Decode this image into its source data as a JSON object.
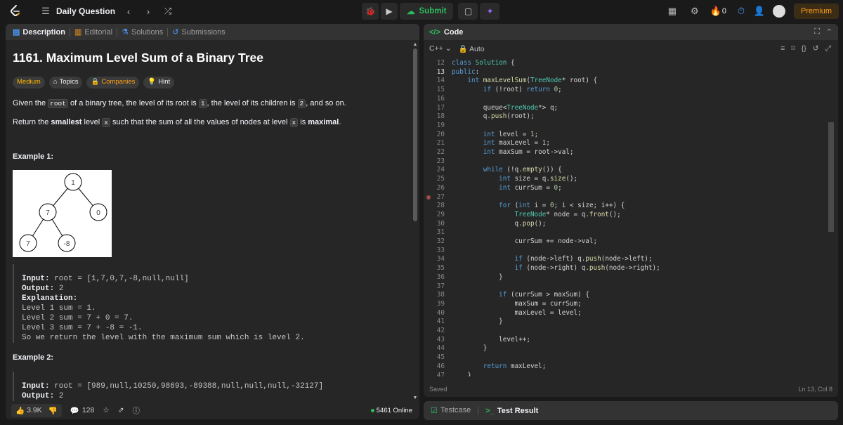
{
  "topbar": {
    "title": "Daily Question",
    "submit": "Submit",
    "streak": "0",
    "premium": "Premium"
  },
  "left_tabs": [
    "Description",
    "Editorial",
    "Solutions",
    "Submissions"
  ],
  "problem": {
    "title": "1161. Maximum Level Sum of a Binary Tree",
    "badges": [
      "Medium",
      "Topics",
      "Companies",
      "Hint"
    ],
    "p1": [
      "Given the ",
      "root",
      " of a binary tree, the level of its root is ",
      "1",
      ", the level of its children is ",
      "2",
      ", and so on."
    ],
    "p2": [
      "Return the ",
      "smallest",
      " level ",
      "x",
      " such that the sum of all the values of nodes at level ",
      "x",
      " is ",
      "maximal",
      "."
    ],
    "example1": "Example 1:",
    "tree": [
      "1",
      "7",
      "0",
      "7",
      "-8"
    ],
    "ex1_lines": [
      [
        "Input:",
        " root = [1,7,0,7,-8,null,null]"
      ],
      [
        "Output:",
        " 2"
      ],
      [
        "Explanation:",
        ""
      ],
      [
        "",
        "Level 1 sum = 1."
      ],
      [
        "",
        "Level 2 sum = 7 + 0 = 7."
      ],
      [
        "",
        "Level 3 sum = 7 + -8 = -1."
      ],
      [
        "",
        "So we return the level with the maximum sum which is level 2."
      ]
    ],
    "example2": "Example 2:",
    "ex2_lines": [
      [
        "Input:",
        " root = [989,null,10250,98693,-89388,null,null,null,-32127]"
      ],
      [
        "Output:",
        " 2"
      ]
    ]
  },
  "footer": {
    "likes": "3.9K",
    "comments": "128",
    "online": "5461 Online"
  },
  "code": {
    "title": "Code",
    "lang": "C++",
    "mode": "Auto",
    "saved": "Saved",
    "cursor": "Ln 13, Col 8",
    "lines": [
      [
        "12",
        "class Solution {"
      ],
      [
        "13",
        "public:"
      ],
      [
        "14",
        "    int maxLevelSum(TreeNode* root) {"
      ],
      [
        "15",
        "        if (!root) return 0;"
      ],
      [
        "16",
        ""
      ],
      [
        "17",
        "        queue<TreeNode*> q;"
      ],
      [
        "18",
        "        q.push(root);"
      ],
      [
        "19",
        ""
      ],
      [
        "20",
        "        int level = 1;"
      ],
      [
        "21",
        "        int maxLevel = 1;"
      ],
      [
        "22",
        "        int maxSum = root->val;"
      ],
      [
        "23",
        ""
      ],
      [
        "24",
        "        while (!q.empty()) {"
      ],
      [
        "25",
        "            int size = q.size();"
      ],
      [
        "26",
        "            int currSum = 0;"
      ],
      [
        "27",
        ""
      ],
      [
        "28",
        "            for (int i = 0; i < size; i++) {"
      ],
      [
        "29",
        "                TreeNode* node = q.front();"
      ],
      [
        "30",
        "                q.pop();"
      ],
      [
        "31",
        ""
      ],
      [
        "32",
        "                currSum += node->val;"
      ],
      [
        "33",
        ""
      ],
      [
        "34",
        "                if (node->left) q.push(node->left);"
      ],
      [
        "35",
        "                if (node->right) q.push(node->right);"
      ],
      [
        "36",
        "            }"
      ],
      [
        "37",
        ""
      ],
      [
        "38",
        "            if (currSum > maxSum) {"
      ],
      [
        "39",
        "                maxSum = currSum;"
      ],
      [
        "40",
        "                maxLevel = level;"
      ],
      [
        "41",
        "            }"
      ],
      [
        "42",
        ""
      ],
      [
        "43",
        "            level++;"
      ],
      [
        "44",
        "        }"
      ],
      [
        "45",
        ""
      ],
      [
        "46",
        "        return maxLevel;"
      ],
      [
        "47",
        "    }"
      ]
    ]
  },
  "bottom_tabs": [
    "Testcase",
    "Test Result"
  ]
}
